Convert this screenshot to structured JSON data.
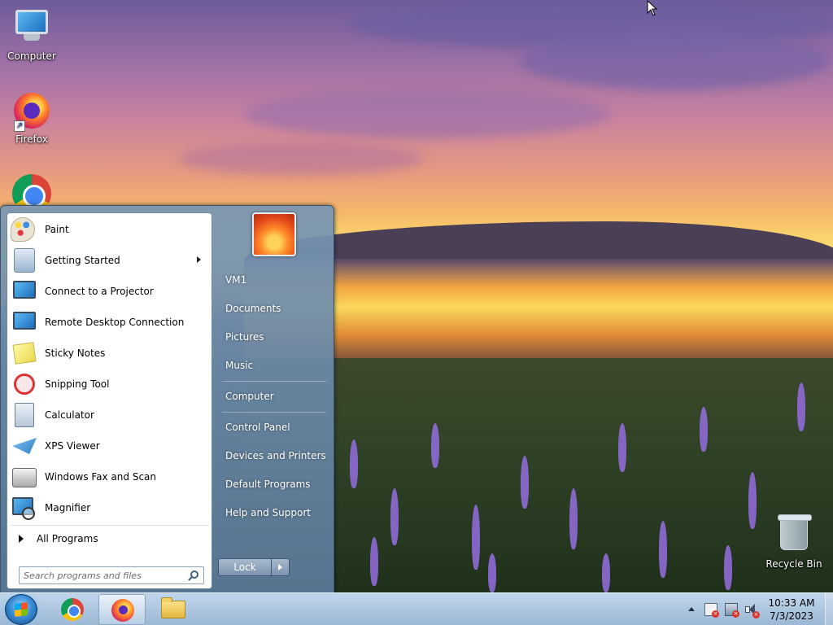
{
  "desktop": {
    "icons": [
      {
        "label": "Computer",
        "icon": "computer-icon"
      },
      {
        "label": "Firefox",
        "icon": "firefox-icon"
      },
      {
        "label": "",
        "icon": "chrome-icon"
      },
      {
        "label": "Recycle Bin",
        "icon": "recycle-bin-icon"
      }
    ]
  },
  "start_menu": {
    "programs": [
      {
        "label": "Paint",
        "icon": "paint-icon",
        "has_submenu": false
      },
      {
        "label": "Getting Started",
        "icon": "getting-started-icon",
        "has_submenu": true
      },
      {
        "label": "Connect to a Projector",
        "icon": "projector-icon",
        "has_submenu": false
      },
      {
        "label": "Remote Desktop Connection",
        "icon": "remote-desktop-icon",
        "has_submenu": false
      },
      {
        "label": "Sticky Notes",
        "icon": "sticky-notes-icon",
        "has_submenu": false
      },
      {
        "label": "Snipping Tool",
        "icon": "snipping-tool-icon",
        "has_submenu": false
      },
      {
        "label": "Calculator",
        "icon": "calculator-icon",
        "has_submenu": false
      },
      {
        "label": "XPS Viewer",
        "icon": "xps-viewer-icon",
        "has_submenu": false
      },
      {
        "label": "Windows Fax and Scan",
        "icon": "fax-scan-icon",
        "has_submenu": false
      },
      {
        "label": "Magnifier",
        "icon": "magnifier-icon",
        "has_submenu": false
      }
    ],
    "all_programs_label": "All Programs",
    "search_placeholder": "Search programs and files",
    "right_links": [
      "VM1",
      "Documents",
      "Pictures",
      "Music",
      "Computer",
      "Control Panel",
      "Devices and Printers",
      "Default Programs",
      "Help and Support"
    ],
    "lock_label": "Lock"
  },
  "taskbar": {
    "pinned": [
      {
        "app": "Google Chrome",
        "icon": "chrome-icon",
        "active": false
      },
      {
        "app": "Firefox",
        "icon": "firefox-icon",
        "active": true
      },
      {
        "app": "Windows Explorer",
        "icon": "folder-icon",
        "active": false
      }
    ],
    "clock": {
      "time": "10:33 AM",
      "date": "7/3/2023"
    }
  },
  "colors": {
    "start_menu_frame": "#5f7d9c",
    "taskbar": "#b3cbe2",
    "text_light": "#ffffff"
  }
}
